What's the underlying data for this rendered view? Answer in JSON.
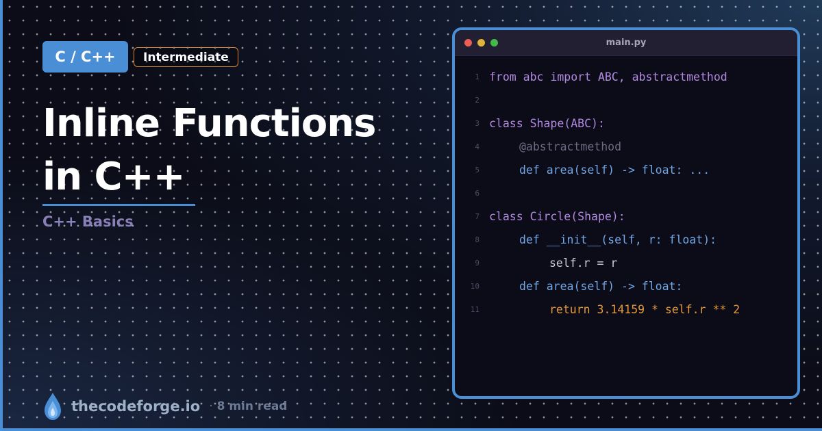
{
  "tags": {
    "language": "C / C++",
    "level": "Intermediate"
  },
  "title": "Inline Functions in C++",
  "subtitle": "C++ Basics",
  "footer": {
    "brand": "thecodeforge.io",
    "separator": "·",
    "read_time": "8 min read"
  },
  "editor": {
    "filename": "main.py",
    "lines": [
      {
        "num": "1",
        "text": "from abc import ABC, abstractmethod"
      },
      {
        "num": "2",
        "text": ""
      },
      {
        "num": "3",
        "text": "class Shape(ABC):"
      },
      {
        "num": "4",
        "text": "@abstractmethod"
      },
      {
        "num": "5",
        "text": "def area(self) -> float: ..."
      },
      {
        "num": "6",
        "text": ""
      },
      {
        "num": "7",
        "text": "class Circle(Shape):"
      },
      {
        "num": "8",
        "text": "def __init__(self, r: float):"
      },
      {
        "num": "9",
        "text": "self.r = r"
      },
      {
        "num": "10",
        "text": "def area(self) -> float:"
      },
      {
        "num": "11",
        "text": "return 3.14159 * self.r ** 2"
      }
    ]
  },
  "colors": {
    "accent": "#4a8fd6",
    "level_border": "#d9892f",
    "subtitle": "#8a80b8"
  },
  "icons": {
    "logo": "flame-drop-icon"
  }
}
